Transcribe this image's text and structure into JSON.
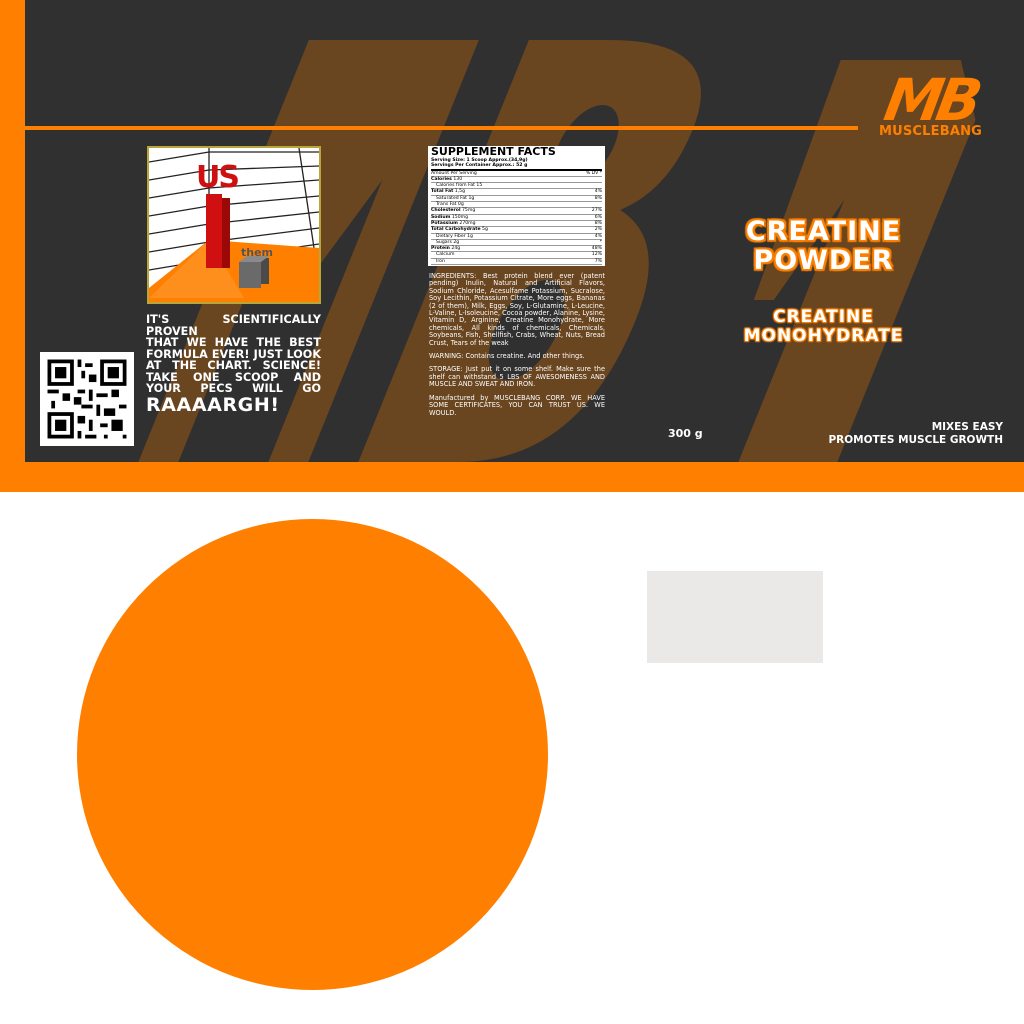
{
  "brand": {
    "mark": "MB",
    "name": "MUSCLEBANG"
  },
  "chart": {
    "us_label": "US",
    "them_label": "them"
  },
  "claim": {
    "lines": [
      "IT'S SCIENTIFICALLY PROVEN",
      "THAT WE HAVE THE BEST",
      "FORMULA EVER! JUST LOOK",
      "AT THE CHART. SCIENCE!",
      "TAKE ONE SCOOP AND",
      "YOUR PECS WILL GO"
    ],
    "shout": "RAAAARGH!"
  },
  "facts": {
    "title": "SUPPLEMENT FACTS",
    "serving_size": "Serving Size: 1 Scoop Approx.(34,9g)",
    "servings": "Servings Per Container Approx.: 52 g",
    "amount_header": "Amount Per Serving",
    "dv_header": "% DV *",
    "rows": [
      {
        "name": "Calories",
        "value": "130",
        "dv": ""
      },
      {
        "name": "Calories from Fat",
        "value": "15",
        "dv": ""
      },
      {
        "name": "Total Fat",
        "value": "1,5g",
        "dv": "4%"
      },
      {
        "name": "Saturated Fat",
        "value": "1g",
        "dv": "8%"
      },
      {
        "name": "Trans Fat",
        "value": "0g",
        "dv": ""
      },
      {
        "name": "Cholesterol",
        "value": "75mg",
        "dv": "27%"
      },
      {
        "name": "Sodium",
        "value": "150mg",
        "dv": "6%"
      },
      {
        "name": "Potassium",
        "value": "270mg",
        "dv": "8%"
      },
      {
        "name": "Total Carbohydrate",
        "value": "5g",
        "dv": "2%"
      },
      {
        "name": "Dietary Fiber",
        "value": "1g",
        "dv": "4%"
      },
      {
        "name": "Sugars",
        "value": "2g",
        "dv": "*"
      },
      {
        "name": "Protein",
        "value": "24g",
        "dv": "48%"
      },
      {
        "name": "Calcium",
        "value": "",
        "dv": "12%"
      },
      {
        "name": "Iron",
        "value": "",
        "dv": "7%"
      }
    ]
  },
  "info": {
    "ingredients": "INGREDIENTS: Best protein blend ever (patent pending) Inulin, Natural and Artificial Flavors, Sodium Chloride, Acesulfame Potassium, Sucralose, Soy Lecithin, Potassium Citrate, More eggs, Bananas (2 of them), Milk, Eggs, Soy, L-Glutamine, L-Leucine, L-Valine, L-Isoleucine, Cocoa powder, Alanine, Lysine, Vitamin D, Arginine, Creatine Monohydrate, More chemicals, All kinds of chemicals, Chemicals, Soybeans, Fish, Shellfish, Crabs, Wheat, Nuts, Bread Crust, Tears of the weak",
    "warning": "WARNING: Contains creatine. And other things.",
    "storage": "STORAGE: Just put it on some shelf. Make sure the shelf can withstand 5 LBS OF AWESOMENESS AND MUSCLE AND SWEAT AND IRON.",
    "manufactured": "Manufactured by MUSCLEBANG CORP. WE HAVE SOME CERTIFICATES, YOU CAN TRUST US. WE WOULD."
  },
  "product": {
    "title_line1": "CREATINE",
    "title_line2": "POWDER",
    "sub_line1": "CREATINE",
    "sub_line2": "MONOHYDRATE",
    "weight": "300 g",
    "claim1": "MIXES EASY",
    "claim2": "PROMOTES MUSCLE GROWTH"
  },
  "colors": {
    "accent": "#ff8000",
    "panel": "#303030",
    "watermark": "#694520",
    "swatch": "#ebe8e8"
  }
}
